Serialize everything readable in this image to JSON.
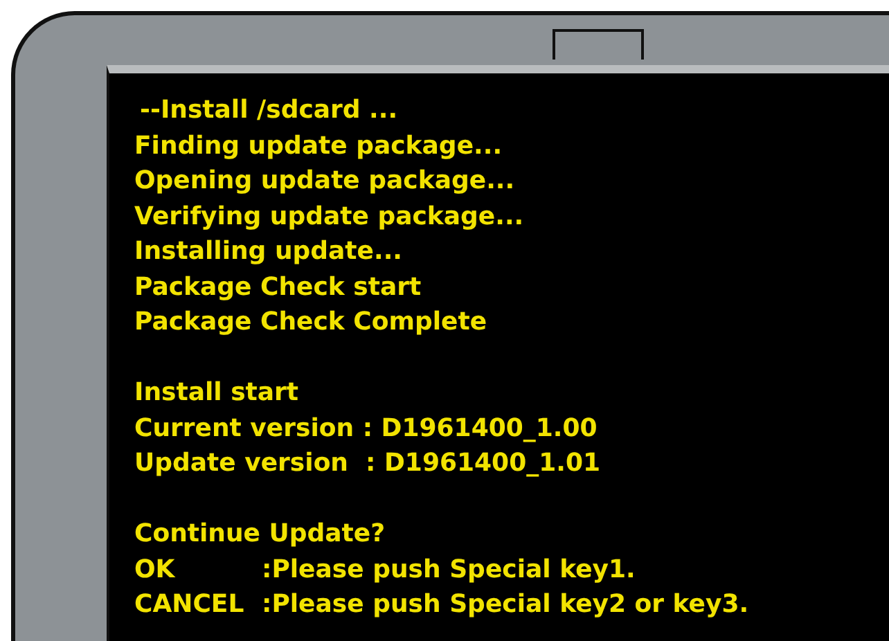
{
  "console": {
    "blocks": [
      {
        "lines": [
          "--Install /sdcard ...",
          "Finding update package...",
          "Opening update package...",
          "Verifying update package...",
          "Installing update...",
          "Package Check start",
          "Package Check Complete"
        ]
      },
      {
        "lines": [
          "Install start",
          "Current version : D1961400_1.00",
          "Update version  : D1961400_1.01"
        ]
      },
      {
        "lines": [
          "Continue Update?"
        ]
      }
    ],
    "options": [
      {
        "key": "OK",
        "action": ":Please push Special key1."
      },
      {
        "key": "CANCEL",
        "action": ":Please push Special key2 or key3."
      }
    ]
  }
}
